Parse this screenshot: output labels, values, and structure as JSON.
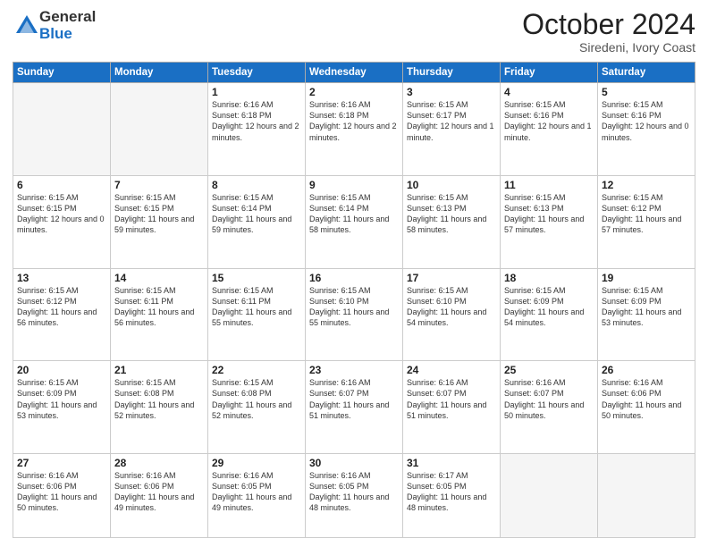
{
  "logo": {
    "general": "General",
    "blue": "Blue"
  },
  "header": {
    "month": "October 2024",
    "location": "Siredeni, Ivory Coast"
  },
  "weekdays": [
    "Sunday",
    "Monday",
    "Tuesday",
    "Wednesday",
    "Thursday",
    "Friday",
    "Saturday"
  ],
  "weeks": [
    [
      {
        "day": "",
        "info": ""
      },
      {
        "day": "",
        "info": ""
      },
      {
        "day": "1",
        "info": "Sunrise: 6:16 AM\nSunset: 6:18 PM\nDaylight: 12 hours and 2 minutes."
      },
      {
        "day": "2",
        "info": "Sunrise: 6:16 AM\nSunset: 6:18 PM\nDaylight: 12 hours and 2 minutes."
      },
      {
        "day": "3",
        "info": "Sunrise: 6:15 AM\nSunset: 6:17 PM\nDaylight: 12 hours and 1 minute."
      },
      {
        "day": "4",
        "info": "Sunrise: 6:15 AM\nSunset: 6:16 PM\nDaylight: 12 hours and 1 minute."
      },
      {
        "day": "5",
        "info": "Sunrise: 6:15 AM\nSunset: 6:16 PM\nDaylight: 12 hours and 0 minutes."
      }
    ],
    [
      {
        "day": "6",
        "info": "Sunrise: 6:15 AM\nSunset: 6:15 PM\nDaylight: 12 hours and 0 minutes."
      },
      {
        "day": "7",
        "info": "Sunrise: 6:15 AM\nSunset: 6:15 PM\nDaylight: 11 hours and 59 minutes."
      },
      {
        "day": "8",
        "info": "Sunrise: 6:15 AM\nSunset: 6:14 PM\nDaylight: 11 hours and 59 minutes."
      },
      {
        "day": "9",
        "info": "Sunrise: 6:15 AM\nSunset: 6:14 PM\nDaylight: 11 hours and 58 minutes."
      },
      {
        "day": "10",
        "info": "Sunrise: 6:15 AM\nSunset: 6:13 PM\nDaylight: 11 hours and 58 minutes."
      },
      {
        "day": "11",
        "info": "Sunrise: 6:15 AM\nSunset: 6:13 PM\nDaylight: 11 hours and 57 minutes."
      },
      {
        "day": "12",
        "info": "Sunrise: 6:15 AM\nSunset: 6:12 PM\nDaylight: 11 hours and 57 minutes."
      }
    ],
    [
      {
        "day": "13",
        "info": "Sunrise: 6:15 AM\nSunset: 6:12 PM\nDaylight: 11 hours and 56 minutes."
      },
      {
        "day": "14",
        "info": "Sunrise: 6:15 AM\nSunset: 6:11 PM\nDaylight: 11 hours and 56 minutes."
      },
      {
        "day": "15",
        "info": "Sunrise: 6:15 AM\nSunset: 6:11 PM\nDaylight: 11 hours and 55 minutes."
      },
      {
        "day": "16",
        "info": "Sunrise: 6:15 AM\nSunset: 6:10 PM\nDaylight: 11 hours and 55 minutes."
      },
      {
        "day": "17",
        "info": "Sunrise: 6:15 AM\nSunset: 6:10 PM\nDaylight: 11 hours and 54 minutes."
      },
      {
        "day": "18",
        "info": "Sunrise: 6:15 AM\nSunset: 6:09 PM\nDaylight: 11 hours and 54 minutes."
      },
      {
        "day": "19",
        "info": "Sunrise: 6:15 AM\nSunset: 6:09 PM\nDaylight: 11 hours and 53 minutes."
      }
    ],
    [
      {
        "day": "20",
        "info": "Sunrise: 6:15 AM\nSunset: 6:09 PM\nDaylight: 11 hours and 53 minutes."
      },
      {
        "day": "21",
        "info": "Sunrise: 6:15 AM\nSunset: 6:08 PM\nDaylight: 11 hours and 52 minutes."
      },
      {
        "day": "22",
        "info": "Sunrise: 6:15 AM\nSunset: 6:08 PM\nDaylight: 11 hours and 52 minutes."
      },
      {
        "day": "23",
        "info": "Sunrise: 6:16 AM\nSunset: 6:07 PM\nDaylight: 11 hours and 51 minutes."
      },
      {
        "day": "24",
        "info": "Sunrise: 6:16 AM\nSunset: 6:07 PM\nDaylight: 11 hours and 51 minutes."
      },
      {
        "day": "25",
        "info": "Sunrise: 6:16 AM\nSunset: 6:07 PM\nDaylight: 11 hours and 50 minutes."
      },
      {
        "day": "26",
        "info": "Sunrise: 6:16 AM\nSunset: 6:06 PM\nDaylight: 11 hours and 50 minutes."
      }
    ],
    [
      {
        "day": "27",
        "info": "Sunrise: 6:16 AM\nSunset: 6:06 PM\nDaylight: 11 hours and 50 minutes."
      },
      {
        "day": "28",
        "info": "Sunrise: 6:16 AM\nSunset: 6:06 PM\nDaylight: 11 hours and 49 minutes."
      },
      {
        "day": "29",
        "info": "Sunrise: 6:16 AM\nSunset: 6:05 PM\nDaylight: 11 hours and 49 minutes."
      },
      {
        "day": "30",
        "info": "Sunrise: 6:16 AM\nSunset: 6:05 PM\nDaylight: 11 hours and 48 minutes."
      },
      {
        "day": "31",
        "info": "Sunrise: 6:17 AM\nSunset: 6:05 PM\nDaylight: 11 hours and 48 minutes."
      },
      {
        "day": "",
        "info": ""
      },
      {
        "day": "",
        "info": ""
      }
    ]
  ]
}
